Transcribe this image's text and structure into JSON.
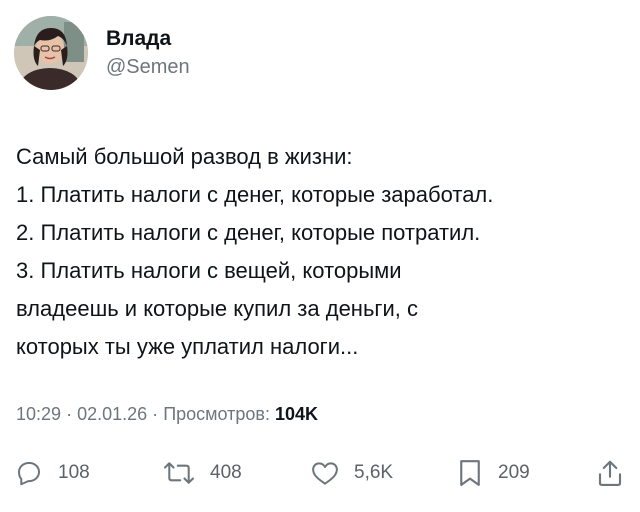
{
  "author": {
    "display_name": "Влада",
    "handle": "@Semen"
  },
  "post": {
    "lines": [
      "Самый большой развод в жизни:",
      "1. Платить налоги с денег, которые заработал.",
      "2. Платить налоги с денег, которые потратил.",
      "3. Платить налоги с вещей, которыми",
      "владеешь и которые купил за деньги, с",
      "которых ты уже уплатил налоги..."
    ]
  },
  "meta": {
    "time": "10:29",
    "separator": "·",
    "date": "02.01.26",
    "views_label": "Просмотров:",
    "views_count": "104K"
  },
  "actions": {
    "replies": {
      "icon": "reply-icon",
      "count": "108"
    },
    "reposts": {
      "icon": "repost-icon",
      "count": "408"
    },
    "likes": {
      "icon": "heart-icon",
      "count": "5,6K"
    },
    "bookmarks": {
      "icon": "bookmark-icon",
      "count": "209"
    },
    "share": {
      "icon": "share-icon"
    }
  },
  "colors": {
    "text": "#0f1419",
    "secondary": "#6e767d",
    "background": "#ffffff"
  }
}
